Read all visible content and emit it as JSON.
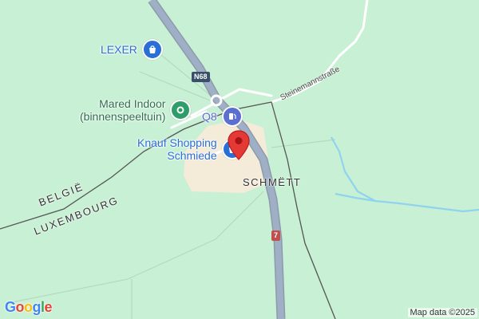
{
  "map": {
    "pois": {
      "lexer": {
        "label": "LEXER",
        "icon": "shopping-bag-icon",
        "color": "#2a6fd6"
      },
      "mared": {
        "label_line1": "Mared Indoor",
        "label_line2": "(binnenspeeltuin)",
        "icon": "leisure-icon",
        "color": "#2e9d6a"
      },
      "q8": {
        "label": "Q8",
        "icon": "gas-station-icon",
        "color": "#5b6fd0"
      },
      "knauf": {
        "label_line1": "Knauf Shopping",
        "label_line2": "Schmiede",
        "icon": "shopping-bag-icon",
        "color": "#2a6fd6"
      }
    },
    "place_label": "SCHMËTT",
    "border_labels": {
      "belgium": "BELGIË",
      "luxembourg": "LUXEMBOURG"
    },
    "road_shields": {
      "n68": "N68",
      "r7": "7"
    },
    "street_label": "Steinemannstraße",
    "selected_marker": {
      "icon": "location-pin-icon",
      "color": "#e53935"
    }
  },
  "footer": {
    "logo_letters": [
      "G",
      "o",
      "o",
      "g",
      "l",
      "e"
    ],
    "attribution": "Map data ©2025"
  }
}
